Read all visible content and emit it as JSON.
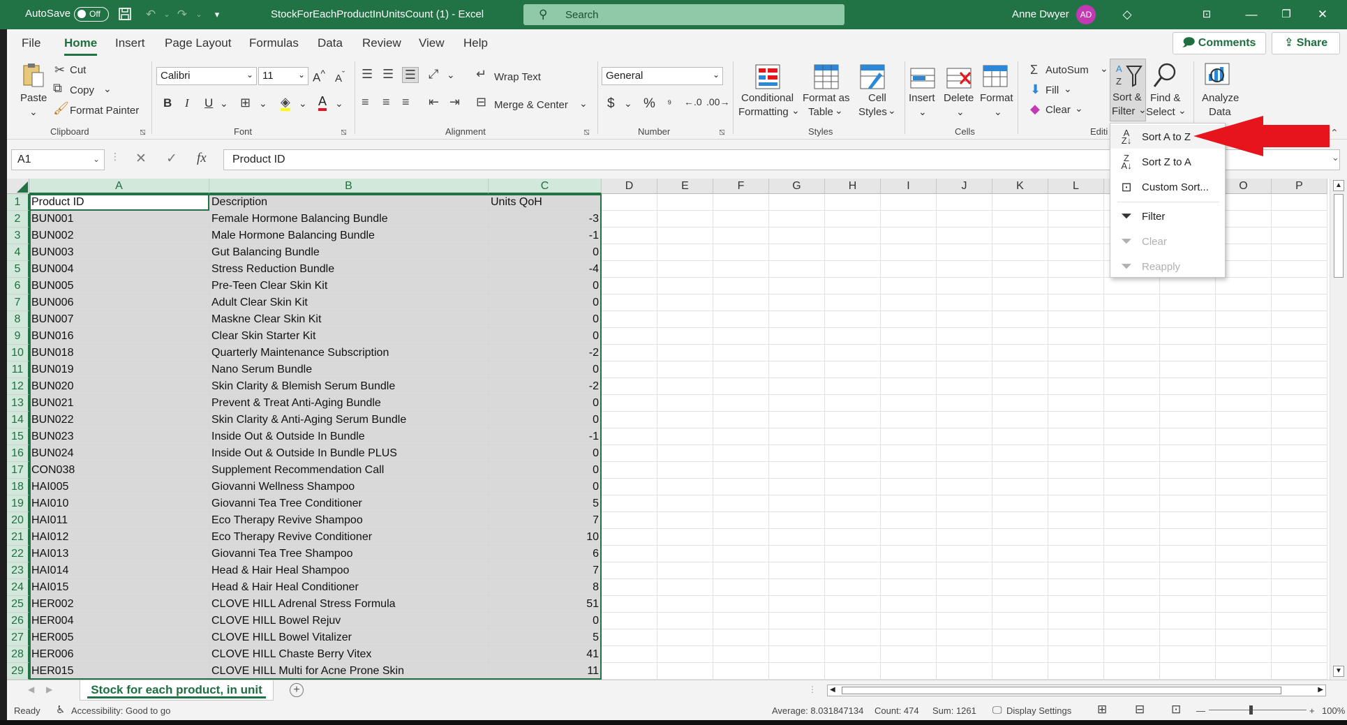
{
  "titlebar": {
    "autosave_label": "AutoSave",
    "autosave_state": "Off",
    "document_title": "StockForEachProductInUnitsCount (1)  -  Excel",
    "search_placeholder": "Search",
    "user_name": "Anne Dwyer",
    "user_initials": "AD"
  },
  "ribbon_tabs": [
    "File",
    "Home",
    "Insert",
    "Page Layout",
    "Formulas",
    "Data",
    "Review",
    "View",
    "Help"
  ],
  "active_tab": "Home",
  "header_buttons": {
    "comments": "Comments",
    "share": "Share"
  },
  "clipboard": {
    "paste": "Paste",
    "cut": "Cut",
    "copy": "Copy",
    "format_painter": "Format Painter",
    "group_label": "Clipboard"
  },
  "font": {
    "name": "Calibri",
    "size": "11",
    "bold": "B",
    "italic": "I",
    "underline": "U",
    "group_label": "Font"
  },
  "alignment": {
    "wrap_text": "Wrap Text",
    "merge_center": "Merge & Center",
    "group_label": "Alignment"
  },
  "number": {
    "format": "General",
    "currency": "$",
    "percent": "%",
    "group_label": "Number"
  },
  "styles": {
    "conditional_1": "Conditional",
    "conditional_2": "Formatting",
    "format_table_1": "Format as",
    "format_table_2": "Table",
    "cell_styles_1": "Cell",
    "cell_styles_2": "Styles",
    "group_label": "Styles"
  },
  "cells": {
    "insert": "Insert",
    "delete": "Delete",
    "format": "Format",
    "group_label": "Cells"
  },
  "editing": {
    "autosum": "AutoSum",
    "fill": "Fill",
    "clear": "Clear",
    "sort_filter_1": "Sort &",
    "sort_filter_2": "Filter",
    "find_select_1": "Find &",
    "find_select_2": "Select",
    "group_label": "Editi"
  },
  "analysis": {
    "analyze_1": "Analyze",
    "analyze_2": "Data"
  },
  "formula_bar": {
    "name_box": "A1",
    "fx": "fx",
    "content": "Product ID"
  },
  "columns": [
    "A",
    "B",
    "C",
    "D",
    "E",
    "F",
    "G",
    "H",
    "I",
    "J",
    "K",
    "L",
    "M",
    "N",
    "O",
    "P"
  ],
  "rows": [
    [
      "Product ID",
      "Description",
      "Units QoH"
    ],
    [
      "BUN001",
      "Female Hormone Balancing Bundle",
      "-3"
    ],
    [
      "BUN002",
      "Male Hormone Balancing Bundle",
      "-1"
    ],
    [
      "BUN003",
      "Gut Balancing Bundle",
      "0"
    ],
    [
      "BUN004",
      "Stress Reduction Bundle",
      "-4"
    ],
    [
      "BUN005",
      "Pre-Teen Clear Skin Kit",
      "0"
    ],
    [
      "BUN006",
      "Adult Clear Skin Kit",
      "0"
    ],
    [
      "BUN007",
      "Maskne Clear Skin Kit",
      "0"
    ],
    [
      "BUN016",
      "Clear Skin Starter Kit",
      "0"
    ],
    [
      "BUN018",
      "Quarterly Maintenance Subscription",
      "-2"
    ],
    [
      "BUN019",
      "Nano Serum Bundle",
      "0"
    ],
    [
      "BUN020",
      "Skin Clarity & Blemish Serum Bundle",
      "-2"
    ],
    [
      "BUN021",
      "Prevent & Treat Anti-Aging Bundle",
      "0"
    ],
    [
      "BUN022",
      "Skin Clarity & Anti-Aging Serum Bundle",
      "0"
    ],
    [
      "BUN023",
      "Inside Out & Outside In Bundle",
      "-1"
    ],
    [
      "BUN024",
      "Inside Out & Outside In Bundle PLUS",
      "0"
    ],
    [
      "CON038",
      "Supplement Recommendation Call",
      "0"
    ],
    [
      "HAI005",
      "Giovanni Wellness Shampoo",
      "0"
    ],
    [
      "HAI010",
      "Giovanni Tea Tree Conditioner",
      "5"
    ],
    [
      "HAI011",
      "Eco Therapy Revive Shampoo",
      "7"
    ],
    [
      "HAI012",
      "Eco Therapy Revive Conditioner",
      "10"
    ],
    [
      "HAI013",
      "Giovanni Tea Tree Shampoo",
      "6"
    ],
    [
      "HAI014",
      "Head & Hair Heal Shampoo",
      "7"
    ],
    [
      "HAI015",
      "Head & Hair Heal Conditioner",
      "8"
    ],
    [
      "HER002",
      "CLOVE HILL Adrenal Stress Formula",
      "51"
    ],
    [
      "HER004",
      "CLOVE HILL Bowel Rejuv",
      "0"
    ],
    [
      "HER005",
      "CLOVE HILL Bowel Vitalizer",
      "5"
    ],
    [
      "HER006",
      "CLOVE HILL Chaste Berry Vitex",
      "41"
    ],
    [
      "HER015",
      "CLOVE HILL Multi for Acne Prone Skin",
      "11"
    ]
  ],
  "sort_menu": {
    "sort_az": "Sort A to Z",
    "sort_za": "Sort Z to A",
    "custom_sort": "Custom Sort...",
    "filter": "Filter",
    "clear": "Clear",
    "reapply": "Reapply"
  },
  "sheet_tab": "Stock for each product, in unit",
  "statusbar": {
    "ready": "Ready",
    "accessibility": "Accessibility: Good to go",
    "average": "Average: 8.031847134",
    "count": "Count: 474",
    "sum": "Sum: 1261",
    "display_settings": "Display Settings",
    "zoom": "100%"
  },
  "colors": {
    "excel_green": "#217346",
    "selection_gray": "#d9d9d9",
    "arrow_red": "#e8141c"
  }
}
